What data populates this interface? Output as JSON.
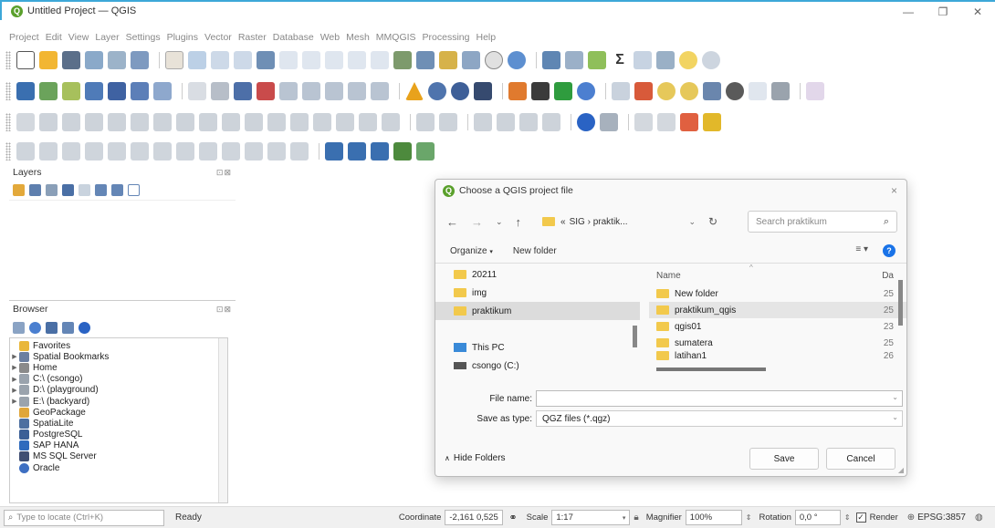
{
  "window": {
    "title": "Untitled Project — QGIS",
    "logo_letter": "Q",
    "accent": "#3da8d8"
  },
  "menubar": [
    "Project",
    "Edit",
    "View",
    "Layer",
    "Settings",
    "Plugins",
    "Vector",
    "Raster",
    "Database",
    "Web",
    "Mesh",
    "MMQGIS",
    "Processing",
    "Help"
  ],
  "toolbar_rows": 4,
  "panels": {
    "layers": {
      "title": "Layers",
      "buttons": "⊡⊠"
    },
    "browser": {
      "title": "Browser",
      "buttons": "⊡⊠",
      "items": [
        {
          "label": "Favorites",
          "icon": "star-icon",
          "expandable": false
        },
        {
          "label": "Spatial Bookmarks",
          "icon": "bookmark-icon",
          "expandable": true
        },
        {
          "label": "Home",
          "icon": "home-icon",
          "expandable": true
        },
        {
          "label": "C:\\ (csongo)",
          "icon": "drive-icon",
          "expandable": true
        },
        {
          "label": "D:\\ (playground)",
          "icon": "drive-icon",
          "expandable": true
        },
        {
          "label": "E:\\ (backyard)",
          "icon": "drive-icon",
          "expandable": true
        },
        {
          "label": "GeoPackage",
          "icon": "geopackage-icon",
          "expandable": false
        },
        {
          "label": "SpatiaLite",
          "icon": "spatialite-icon",
          "expandable": false
        },
        {
          "label": "PostgreSQL",
          "icon": "postgresql-icon",
          "expandable": false
        },
        {
          "label": "SAP HANA",
          "icon": "sap-hana-icon",
          "expandable": false
        },
        {
          "label": "MS SQL Server",
          "icon": "mssql-icon",
          "expandable": false
        },
        {
          "label": "Oracle",
          "icon": "oracle-icon",
          "expandable": false
        }
      ]
    }
  },
  "dialog": {
    "title": "Choose a QGIS project file",
    "close": "×",
    "path_prefix": "«",
    "path": "SIG › praktik...",
    "search_placeholder": "Search praktikum",
    "organize": "Organize",
    "new_folder": "New folder",
    "nav_items": [
      {
        "label": "20211",
        "selected": false,
        "icon": "folder-icon"
      },
      {
        "label": "img",
        "selected": false,
        "icon": "folder-icon"
      },
      {
        "label": "praktikum",
        "selected": true,
        "icon": "folder-icon"
      },
      {
        "label": "",
        "selected": false,
        "icon": ""
      },
      {
        "label": "This PC",
        "selected": false,
        "icon": "computer-icon"
      },
      {
        "label": "csongo (C:)",
        "selected": false,
        "icon": "drive-icon"
      }
    ],
    "columns": {
      "name": "Name",
      "date": "Da"
    },
    "files": [
      {
        "name": "New folder",
        "date": "25",
        "selected": false
      },
      {
        "name": "praktikum_qgis",
        "date": "25",
        "selected": true
      },
      {
        "name": "qgis01",
        "date": "23",
        "selected": false
      },
      {
        "name": "sumatera",
        "date": "25",
        "selected": false
      },
      {
        "name": "latihan1",
        "date": "26",
        "selected": false
      }
    ],
    "file_name_label": "File name:",
    "file_name_value": "",
    "save_type_label": "Save as type:",
    "save_type_value": "QGZ files (*.qgz)",
    "hide_folders": "Hide Folders",
    "save": "Save",
    "cancel": "Cancel"
  },
  "statusbar": {
    "locator_placeholder": "Type to locate (Ctrl+K)",
    "ready": "Ready",
    "coordinate_label": "Coordinate",
    "coordinate_value": "-2,161 0,525",
    "scale_label": "Scale",
    "scale_value": "1:17",
    "magnifier_label": "Magnifier",
    "magnifier_value": "100%",
    "rotation_label": "Rotation",
    "rotation_value": "0,0 °",
    "render_label": "Render",
    "crs": "EPSG:3857"
  }
}
